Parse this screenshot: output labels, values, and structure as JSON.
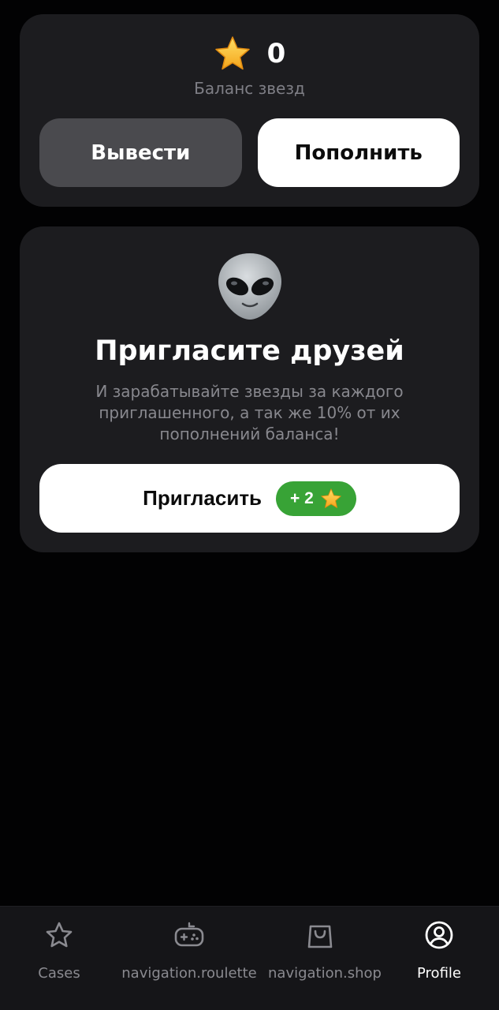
{
  "balance": {
    "star_icon": "star-emoji",
    "value": "0",
    "label": "Баланс звезд",
    "withdraw_label": "Вывести",
    "topup_label": "Пополнить"
  },
  "invite": {
    "icon": "alien-emoji",
    "title": "Пригласите друзей",
    "description": "И зарабатывайте звезды за каждого приглашенного, а так же 10% от их пополнений баланса!",
    "button_label": "Пригласить",
    "reward": "+ 2",
    "reward_icon": "star-emoji",
    "reward_color": "#38a336"
  },
  "nav": {
    "items": [
      {
        "label": "Cases",
        "icon": "star-outline-icon",
        "active": false
      },
      {
        "label": "navigation.roulette",
        "icon": "gamepad-icon",
        "active": false
      },
      {
        "label": "navigation.shop",
        "icon": "shopping-bag-icon",
        "active": false
      },
      {
        "label": "Profile",
        "icon": "user-circle-icon",
        "active": true
      }
    ]
  },
  "colors": {
    "background": "#020203",
    "card": "#1c1c1f",
    "accent_green": "#38a336",
    "muted_text": "#88888e"
  }
}
